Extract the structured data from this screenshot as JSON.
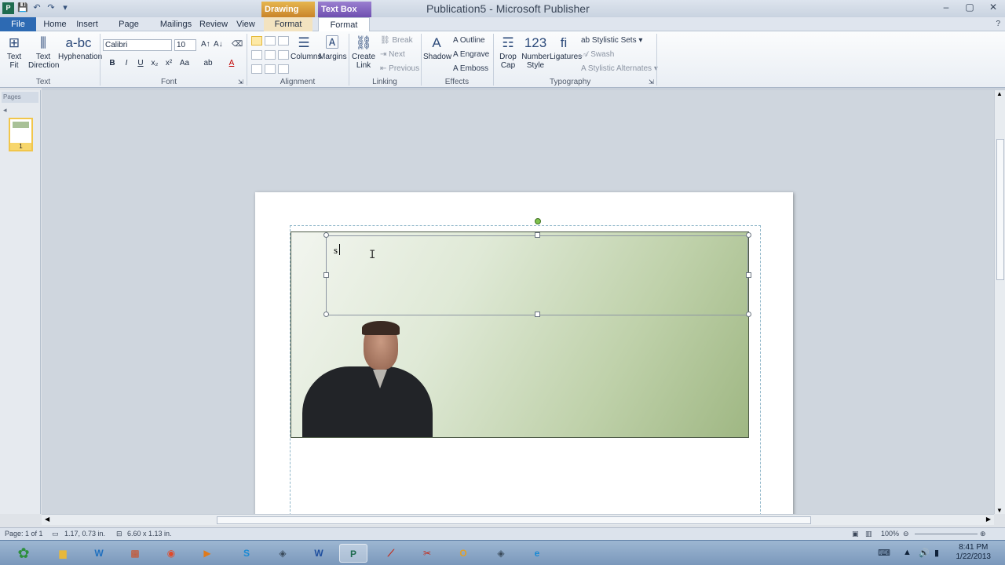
{
  "titlebar": {
    "app_icon": "P",
    "qat": [
      "save-icon",
      "undo-icon",
      "redo-icon",
      "customize-icon"
    ],
    "context_tabs": [
      "Drawing Tools",
      "Text Box Tools"
    ],
    "title": "Publication5  -  Microsoft Publisher",
    "controls": [
      "–",
      "▢",
      "✕"
    ]
  },
  "tabs": {
    "file": "File",
    "home": "Home",
    "insert": "Insert",
    "page_design": "Page Design",
    "mailings": "Mailings",
    "review": "Review",
    "view": "View",
    "format_drawing": "Format",
    "format_textbox": "Format"
  },
  "ribbon": {
    "text_group": {
      "label": "Text",
      "text_fit": "Text\nFit",
      "text_direction": "Text\nDirection",
      "hyphenation": "Hyphenation"
    },
    "font_group": {
      "label": "Font",
      "font_name": "Calibri",
      "font_size": "10",
      "bold": "B",
      "italic": "I",
      "underline": "U",
      "subscript": "x₂",
      "superscript": "x²",
      "change_case": "Aa",
      "highlight": "ab",
      "font_color": "A"
    },
    "alignment_group": {
      "label": "Alignment",
      "columns": "Columns",
      "margins": "Margins"
    },
    "linking_group": {
      "label": "Linking",
      "create_link": "Create\nLink",
      "break": "Break",
      "next": "Next",
      "previous": "Previous"
    },
    "effects_group": {
      "label": "Effects",
      "shadow": "Shadow",
      "outline": "Outline",
      "engrave": "Engrave",
      "emboss": "Emboss"
    },
    "typography_group": {
      "label": "Typography",
      "drop_cap": "Drop\nCap",
      "number_style": "Number\nStyle",
      "ligatures": "Ligatures",
      "stylistic_sets": "Stylistic Sets",
      "swash": "Swash",
      "stylistic_alternates": "Stylistic Alternates"
    }
  },
  "nav_pane": {
    "header": "Pages",
    "page_number": "1"
  },
  "canvas": {
    "textbox_text": "s"
  },
  "status": {
    "page": "Page: 1 of 1",
    "position": "1.17, 0.73 in.",
    "size": "6.60 x 1.13 in.",
    "zoom": "100%"
  },
  "taskbar": {
    "time": "8:41 PM",
    "date": "1/22/2013"
  },
  "colors": {
    "file_tab": "#2d6ab3",
    "drawing_tools": "#c9842a",
    "text_box_tools": "#6f4fb0"
  }
}
